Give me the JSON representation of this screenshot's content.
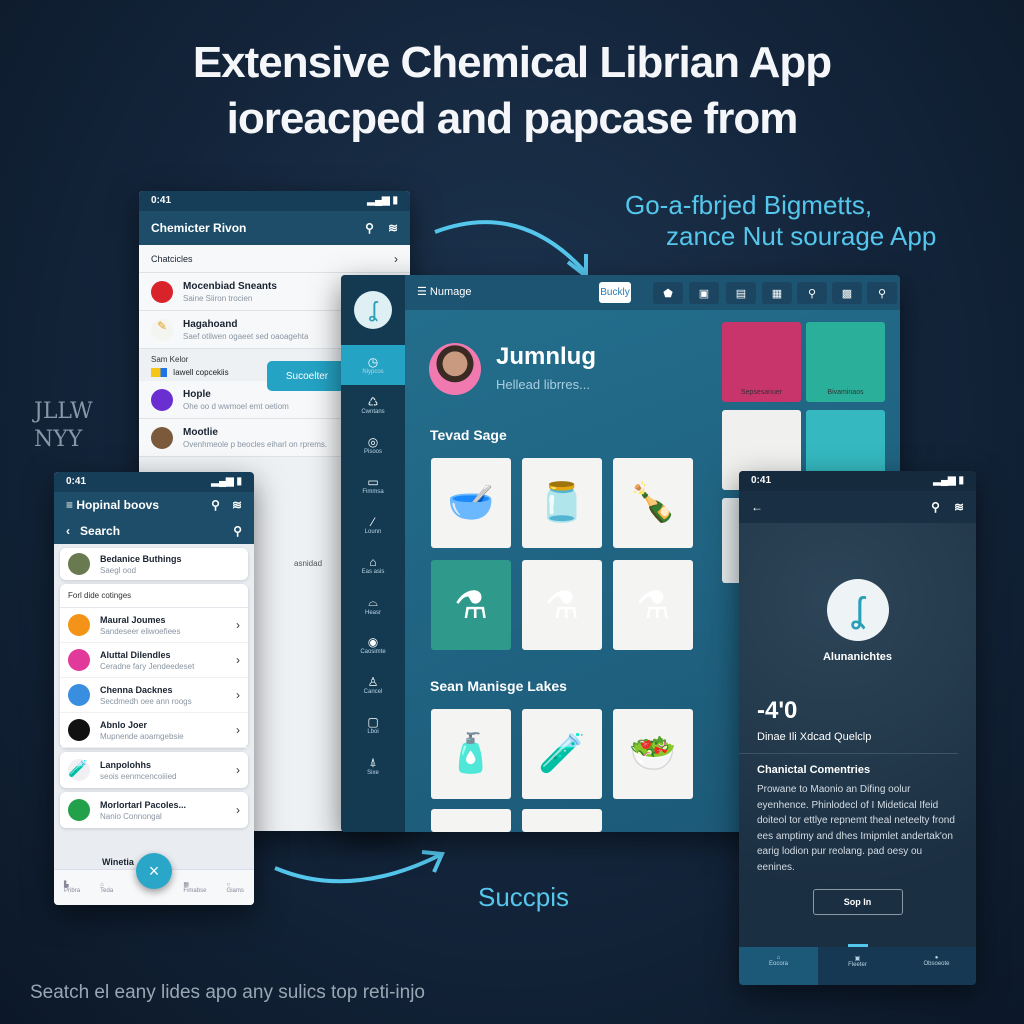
{
  "headline": {
    "line1": "Extensive Chemical Librian App",
    "line2": "ioreacped and papcase from"
  },
  "callout": {
    "line1": "Go-a-fbrjed Bigmetts,",
    "line2": "zance Nut sourage App"
  },
  "side_logo": {
    "line1": "JLLW",
    "line2": "NYY"
  },
  "success_label": "Succpis",
  "footer_text": "Seatch el eany lides apo any sulics top reti-injo",
  "accent": "#55c6ec",
  "phone1": {
    "time": "0:41",
    "title": "Chemicter Rivon",
    "section": "Chatcicles",
    "items": [
      {
        "title": "Mocenbiad Sneants",
        "sub": "Saine Siiron trocien"
      },
      {
        "title": "Hagahoand",
        "sub": "Saef otilwen ogaeet sed oaoagehta"
      },
      {
        "title": "Hople",
        "sub": "Ohe oo d wwmoel emt oetiom"
      },
      {
        "title": "Mootlie",
        "sub": "Ovenhmeole p beocles eiharl on rprems."
      }
    ],
    "subsection": "Sam Kelor",
    "folder_label": "Iawell copcekiis",
    "tooltip": "Sucoelter",
    "extra": "asnidad"
  },
  "tablet": {
    "menu_title": "Numage",
    "top_button": "Buckly",
    "profile_name": "Jumnlug",
    "profile_sub": "Hellead librres...",
    "section1": "Tevad Sage",
    "section2": "Sean Manisge Lakes",
    "nav": [
      "Niypcos",
      "Cwntans",
      "Pisoos",
      "Fimmsa",
      "Lounn",
      "Eas asis",
      "Heasr",
      "Caosimte",
      "Cancel",
      "Lboi",
      "Sixe"
    ],
    "image_captions": [
      "Sepsesanuer",
      "Bivaminaos"
    ]
  },
  "phone2": {
    "time": "0:41",
    "title": "Hopinal boovs",
    "search": "Search",
    "top_item": {
      "title": "Bedanice Buthings",
      "sub": "Saegl ood"
    },
    "section": "Forl dide cotinges",
    "items": [
      {
        "title": "Maural Joumes",
        "sub": "Sandeseer eliwoefiees"
      },
      {
        "title": "Aluttal Dilendles",
        "sub": "Ceradne fary Jendeedeset"
      },
      {
        "title": "Chenna Dacknes",
        "sub": "Secdmedh oee ann roogs"
      },
      {
        "title": "Abnlo Joer",
        "sub": "Mupnende aoamgebsie"
      },
      {
        "title": "Lanpolohhs",
        "sub": "seois eenmcencoiiied"
      },
      {
        "title": "Morlortarl Pacoles...",
        "sub": "Nanio Connongal"
      },
      {
        "title": "Winetia",
        "sub": ""
      }
    ],
    "tabs": [
      "Pribra",
      "Teda",
      "Fimabse",
      "Giams"
    ]
  },
  "phone3": {
    "time": "0:41",
    "name": "Alunanichtes",
    "stat": "-4'0",
    "stat_label": "Dinae Ili Xdcad Quelclp",
    "section": "Chanictal Comentries",
    "body": "Prowane to Maonio an Difing oolur eyenhence. Phinlodecl of I Midetical Ifeid doiteol tor ettlye repnemt theal neteelty frond ees amptimy and dhes Imipmlet andertak'on earig lodion pur reolang. pad oesy ou eenines.",
    "button": "Sop In",
    "tabs": [
      "Eocora",
      "Fleeter",
      "Obsoeote"
    ]
  }
}
